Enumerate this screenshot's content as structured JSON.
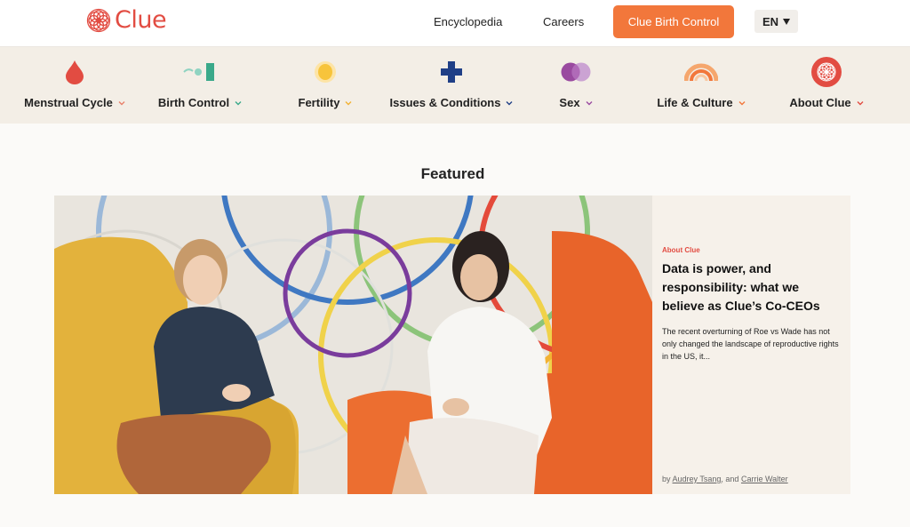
{
  "header": {
    "logo_text": "Clue",
    "links": [
      "Encyclopedia",
      "Careers"
    ],
    "cta_label": "Clue Birth Control",
    "lang_label": "EN"
  },
  "nav": {
    "categories": [
      {
        "label": "Menstrual Cycle",
        "icon": "blood-drop-icon",
        "chevron_color": "#e8806a"
      },
      {
        "label": "Birth Control",
        "icon": "pill-pack-icon",
        "chevron_color": "#3aa98a"
      },
      {
        "label": "Fertility",
        "icon": "egg-icon",
        "chevron_color": "#f2b233"
      },
      {
        "label": "Issues & Conditions",
        "icon": "medical-cross-icon",
        "chevron_color": "#1f3f86"
      },
      {
        "label": "Sex",
        "icon": "overlapping-circles-icon",
        "chevron_color": "#9a4aa0"
      },
      {
        "label": "Life & Culture",
        "icon": "rainbow-icon",
        "chevron_color": "#f2773b"
      },
      {
        "label": "About Clue",
        "icon": "clue-flower-icon",
        "chevron_color": "#e24c42"
      }
    ]
  },
  "featured": {
    "heading": "Featured",
    "article": {
      "kicker": "About Clue",
      "title": "Data is power, and responsibility: what we believe as Clue’s Co-CEOs",
      "excerpt": "The recent overturning of Roe vs Wade has not only changed the landscape of reproductive rights in the US, it...",
      "byline_prefix": "by",
      "authors": [
        "Audrey Tsang",
        "Carrie Walter"
      ],
      "author_separator": ", and"
    }
  },
  "colors": {
    "brand_red": "#e24c42",
    "cta_orange": "#f2773b",
    "nav_background": "#f3eee6",
    "card_background": "#f6f1ea"
  }
}
